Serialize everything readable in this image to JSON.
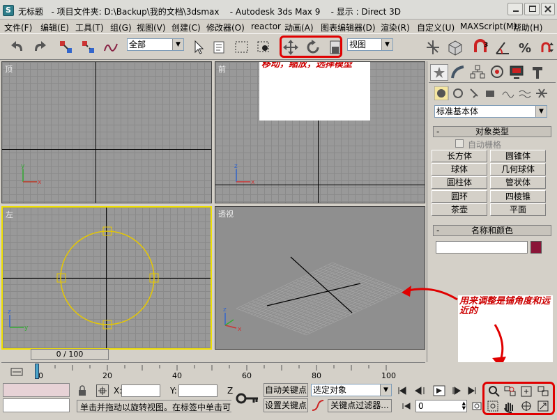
{
  "window": {
    "title": "无标题   - 项目文件夹: D:\\Backup\\我的文档\\3dsmax    - Autodesk 3ds Max 9    - 显示 : Direct 3D",
    "app_icon_letter": "S"
  },
  "menu": [
    "文件(F)",
    "编辑(E)",
    "工具(T)",
    "组(G)",
    "视图(V)",
    "创建(C)",
    "修改器(O)",
    "reactor",
    "动画(A)",
    "图表编辑器(D)",
    "渲染(R)",
    "自定义(U)",
    "MAXScript(M)",
    "帮助(H)"
  ],
  "toolbar": {
    "selection_filter": "全部",
    "ref_coord": "视图"
  },
  "annotations": {
    "top": "移动，缩放，选择模型",
    "bottom_right": "用来调整是铺角度和远近的"
  },
  "viewports": {
    "top": "顶",
    "front": "前",
    "left": "左",
    "perspective": "透视"
  },
  "command_panel": {
    "category": "标准基本体",
    "object_type_header": "对象类型",
    "autogrid": "自动栅格",
    "primitives": [
      "长方体",
      "圆锥体",
      "球体",
      "几何球体",
      "圆柱体",
      "管状体",
      "圆环",
      "四棱锥",
      "茶壶",
      "平面"
    ],
    "name_color_header": "名称和颜色",
    "object_color": "#8a1538"
  },
  "timeline": {
    "frame_label": "0 / 100",
    "ticks": [
      "0",
      "20",
      "40",
      "60",
      "80",
      "100"
    ]
  },
  "status": {
    "x_label": "X:",
    "y_label": "Y:",
    "z_label": "Z",
    "prompt": "单击并拖动以旋转视图。在标签中单击可",
    "auto_key": "自动关键点",
    "set_key": "设置关键点",
    "key_mode": "选定对象",
    "key_filters": "关键点过滤器...",
    "current_frame": "0"
  },
  "colors": {
    "annotation": "#cc0000",
    "active_viewport_border": "#f0e000",
    "selected_object": "#e6c800"
  }
}
